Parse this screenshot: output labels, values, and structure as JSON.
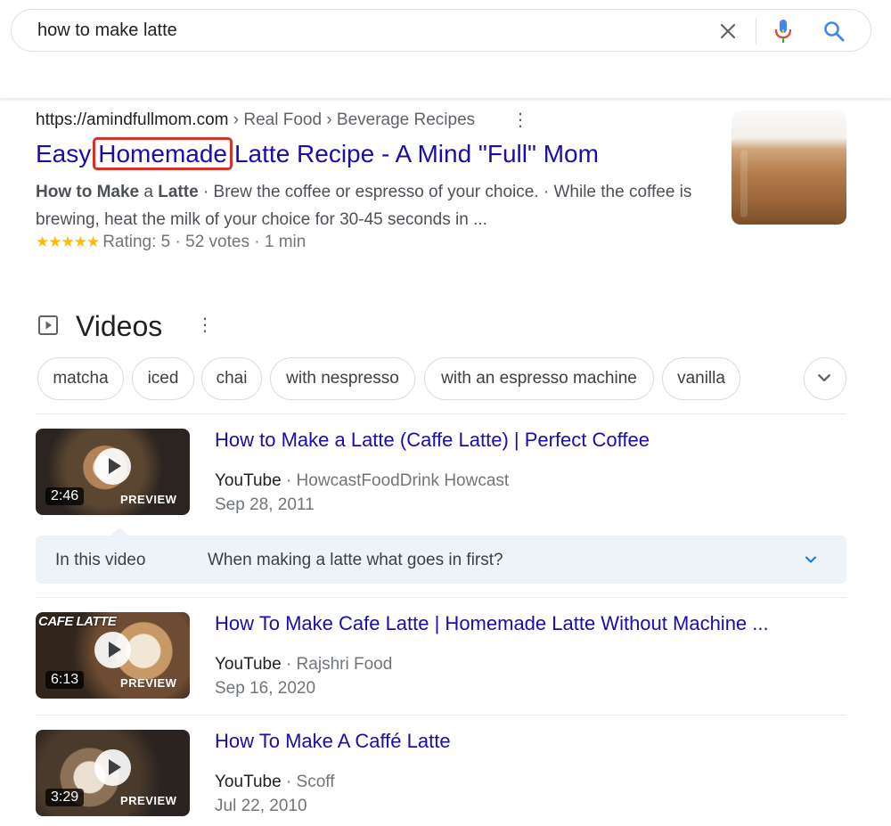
{
  "search": {
    "query": "how to make latte"
  },
  "top_result": {
    "url_domain": "https://amindfullmom.com",
    "url_crumbs": " › Real Food › Beverage Recipes",
    "title_before": "Easy",
    "title_highlight": "Homemade",
    "title_after": "Latte Recipe - A Mind \"Full\" Mom",
    "snippet_bold": "How to Make",
    "snippet_mid": " a ",
    "snippet_bold2": "Latte",
    "snippet_rest": " · Brew the coffee or espresso of your choice. · While the coffee is brewing, heat the milk of your choice for 30-45 seconds in ...",
    "stars": "★★★★★",
    "rating_text": "Rating: 5 · 52 votes · 1 min",
    "rating_value": 5
  },
  "videos": {
    "title": "Videos",
    "chips": [
      "matcha",
      "iced",
      "chai",
      "with nespresso",
      "with an espresso machine",
      "vanilla"
    ],
    "items": [
      {
        "title": "How to Make a Latte (Caffe Latte) | Perfect Coffee",
        "source": "YouTube",
        "channel": " · HowcastFoodDrink Howcast",
        "date": "Sep 28, 2011",
        "duration": "2:46",
        "preview": "PREVIEW"
      },
      {
        "title": "How To Make Cafe Latte | Homemade Latte Without Machine ...",
        "source": "YouTube",
        "channel": " · Rajshri Food",
        "date": "Sep 16, 2020",
        "duration": "6:13",
        "preview": "PREVIEW",
        "thumb_caption": "CAFE LATTE"
      },
      {
        "title": "How To Make A Caffé Latte",
        "source": "YouTube",
        "channel": " · Scoff",
        "date": "Jul 22, 2010",
        "duration": "3:29",
        "preview": "PREVIEW"
      }
    ],
    "in_video": {
      "label": "In this video",
      "question": "When making a latte what goes in first?"
    }
  },
  "colors": {
    "link": "#1a0dab",
    "highlight_border": "#d93025",
    "star": "#fbbc04",
    "panel_bg": "#eef3fa"
  }
}
